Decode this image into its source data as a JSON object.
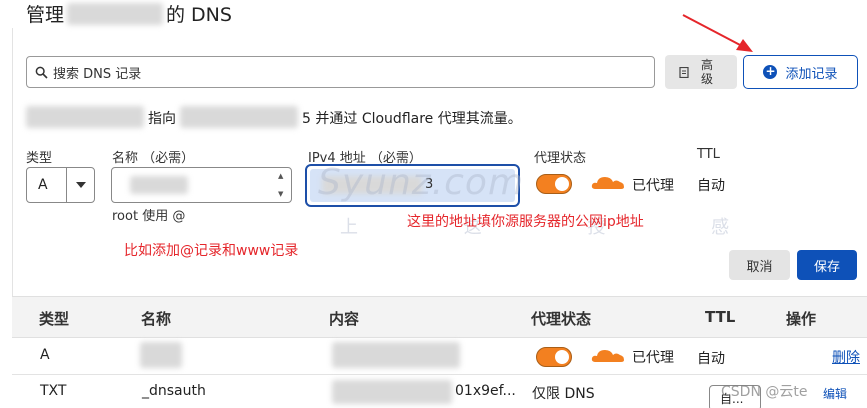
{
  "header": {
    "title_prefix": "管理",
    "title_suffix": "的 DNS"
  },
  "toolbar": {
    "search_placeholder": "搜索 DNS 记录",
    "advanced_label_top": "高",
    "advanced_label_bottom": "级",
    "add_record_label": "添加记录"
  },
  "info": {
    "middle": "指向",
    "tail_digit": "5",
    "suffix": "并通过 Cloudflare 代理其流量。"
  },
  "form": {
    "labels": {
      "type": "类型",
      "name": "名称 （必需）",
      "ipv4": "IPv4 地址 （必需）",
      "proxy_status": "代理状态",
      "ttl": "TTL"
    },
    "type_value": "A",
    "root_hint": "root 使用 @",
    "ipv4_tail": "3",
    "proxy_state_label": "已代理",
    "ttl_value": "自动",
    "cancel_label": "取消",
    "save_label": "保存"
  },
  "annotations": {
    "note_ip": "这里的地址填你源服务器的公网ip地址",
    "note_records": "比如添加@记录和www记录",
    "watermark_text": "Syunz.com",
    "watermark_chars": "上 这 授 感"
  },
  "table": {
    "headers": [
      "类型",
      "名称",
      "内容",
      "代理状态",
      "TTL",
      "操作"
    ],
    "rows": [
      {
        "type": "A",
        "name": "",
        "content": "",
        "proxy": "已代理",
        "ttl": "自动",
        "action": "删除"
      },
      {
        "type": "TXT",
        "name": "_dnsauth",
        "content": "01x9ef...",
        "proxy": "仅限 DNS",
        "ttl": "",
        "action": "编辑"
      }
    ]
  },
  "row2_edit_prefix": "自...",
  "csdn_watermark": "CSDN @云te",
  "colors": {
    "accent_blue": "#0e51b8",
    "cloud_orange": "#f38020",
    "annotation_red": "#e5262b"
  }
}
